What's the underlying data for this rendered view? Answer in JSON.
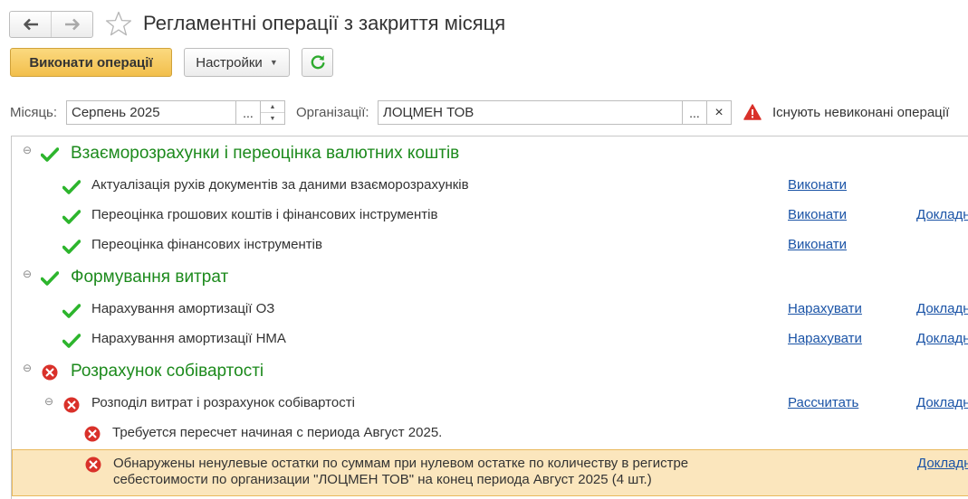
{
  "window": {
    "title": "Регламентні операції з закриття місяця"
  },
  "toolbar": {
    "execute_label": "Виконати операції",
    "settings_label": "Настройки",
    "refresh_icon": "refresh-icon"
  },
  "filters": {
    "month_label": "Місяць:",
    "month_value": "Серпень 2025",
    "month_select_label": "...",
    "org_label": "Організації:",
    "org_value": "ЛОЦМЕН ТОВ",
    "org_select_label": "...",
    "org_clear_label": "×",
    "warning_text": "Існують невиконані операції"
  },
  "colors": {
    "success": "#2db52d",
    "error": "#d9312a",
    "section_title": "#1c8a1c",
    "link": "#1a53a6",
    "highlight": "#fbe6bd"
  },
  "sections": [
    {
      "title": "Взаєморозрахунки і переоцінка валютних коштів",
      "status": "ok",
      "items": [
        {
          "text": "Актуалізація рухів документів за даними взаєморозрахунків",
          "action": "Виконати",
          "report": ""
        },
        {
          "text": "Переоцінка грошових коштів і фінансових інструментів",
          "action": "Виконати",
          "report": "Докладн"
        },
        {
          "text": "Переоцінка фінансових інструментів",
          "action": "Виконати",
          "report": ""
        }
      ]
    },
    {
      "title": "Формування витрат",
      "status": "ok",
      "items": [
        {
          "text": "Нарахування амортизації ОЗ",
          "action": "Нарахувати",
          "report": "Докладн"
        },
        {
          "text": "Нарахування амортизації НМА",
          "action": "Нарахувати",
          "report": "Докладн"
        }
      ]
    },
    {
      "title": "Розрахунок собівартості",
      "status": "error",
      "items": [
        {
          "text": "Розподіл витрат і розрахунок собівартості",
          "action": "Рассчитать",
          "report": "Докладн",
          "errors": [
            {
              "text": "Требуется пересчет начиная с периода Август 2025."
            },
            {
              "line1": "Обнаружены ненулевые остатки по суммам при нулевом остатке по количеству в регистре",
              "line2": "себестоимости по организации \"ЛОЦМЕН ТОВ\" на конец периода Август 2025 (4 шт.)",
              "report": "Докладн"
            }
          ]
        }
      ]
    }
  ]
}
